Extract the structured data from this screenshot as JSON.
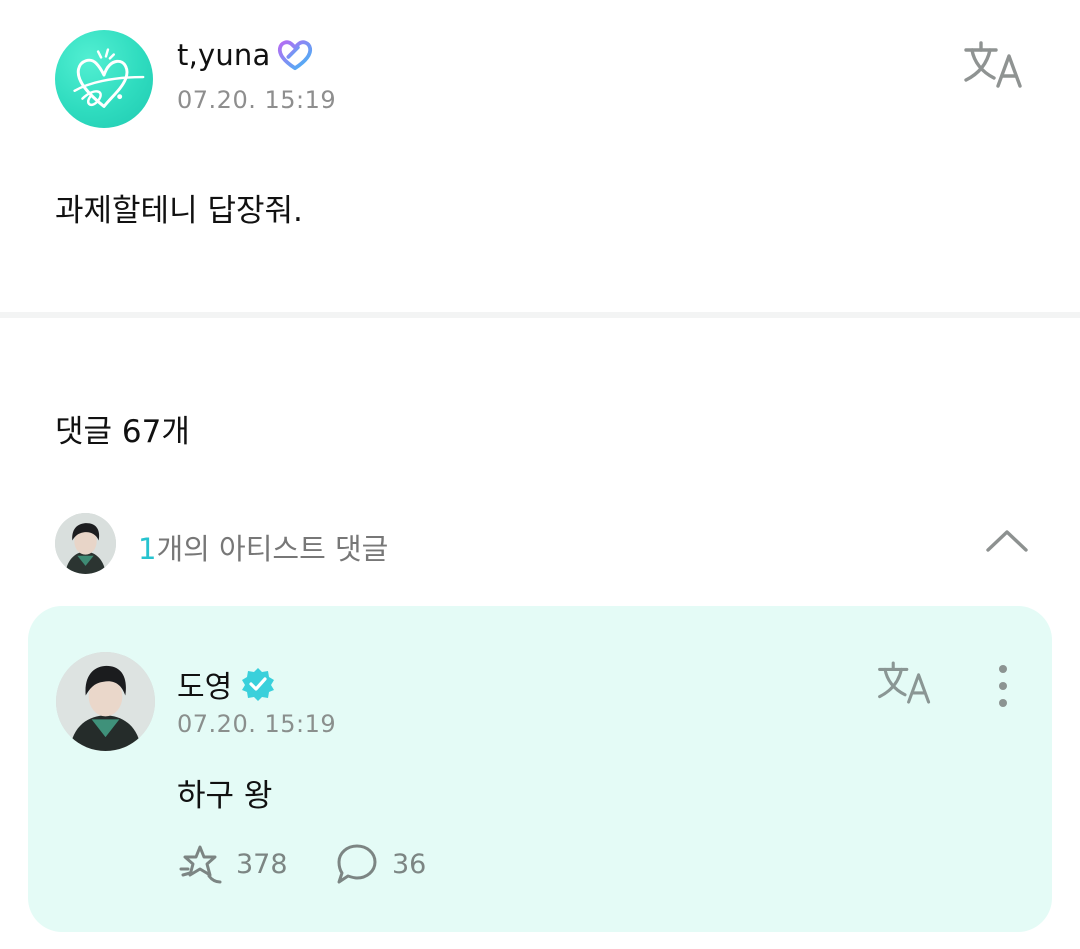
{
  "post": {
    "author_name": "t,yuna",
    "author_badge_icon": "heart-badge-icon",
    "timestamp": "07.20. 15:19",
    "translate_icon": "translate-icon",
    "body": "과제할테니 답장줘."
  },
  "comments": {
    "count_label": "댓글 67개",
    "artist_summary": {
      "count": "1",
      "label": "개의 아티스트 댓글",
      "chevron_icon": "chevron-up-icon"
    },
    "artist_comment": {
      "author_name": "도영",
      "verified_icon": "verified-badge-icon",
      "timestamp": "07.20. 15:19",
      "body": "하구 왕",
      "like_count": "378",
      "reply_count": "36"
    }
  },
  "colors": {
    "accent": "#27c3cf",
    "card_background": "#e4fbf6",
    "avatar_teal": "#2fdcbf",
    "muted_text": "#8e8e8e"
  }
}
